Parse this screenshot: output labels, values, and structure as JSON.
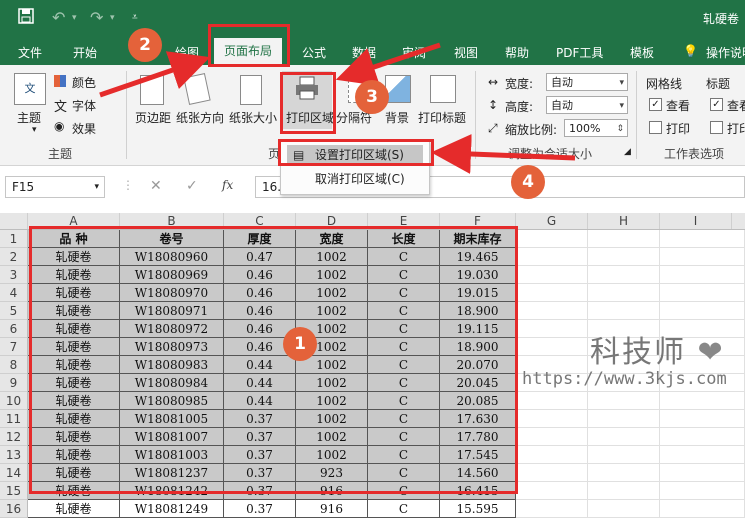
{
  "window": {
    "title": "轧硬卷"
  },
  "quick_access": {
    "save": "save-icon",
    "undo": "undo-icon",
    "redo": "redo-icon",
    "customize": "customize-icon"
  },
  "tabs": [
    "文件",
    "开始",
    "绘图",
    "页面布局",
    "公式",
    "数据",
    "审阅",
    "视图",
    "帮助",
    "PDF工具",
    "模板",
    "操作说明"
  ],
  "active_tab": "页面布局",
  "ribbon": {
    "themes": {
      "theme": "主题",
      "colors": "颜色",
      "fonts": "字体",
      "effects": "效果",
      "group": "主题"
    },
    "page_setup": {
      "margins": "页边距",
      "orientation": "纸张方向",
      "size": "纸张大小",
      "print_area": "打印区域",
      "breaks": "分隔符",
      "background": "背景",
      "print_titles": "打印标题",
      "group": "页"
    },
    "scale": {
      "width_label": "宽度:",
      "width_value": "自动",
      "height_label": "高度:",
      "height_value": "自动",
      "scale_label": "缩放比例:",
      "scale_value": "100%",
      "group": "调整为合适大小"
    },
    "sheet_options": {
      "gridlines": "网格线",
      "headings": "标题",
      "view": "查看",
      "print": "打印",
      "group": "工作表选项"
    }
  },
  "dropdown": {
    "set": "设置打印区域(S)",
    "cancel": "取消打印区域(C)"
  },
  "formula_bar": {
    "name_box": "F15",
    "fx": "fx",
    "content": "16.415"
  },
  "columns": [
    "A",
    "B",
    "C",
    "D",
    "E",
    "F",
    "G",
    "H",
    "I"
  ],
  "table": {
    "headers": [
      "品  种",
      "卷号",
      "厚度",
      "宽度",
      "长度",
      "期末库存"
    ],
    "rows": [
      [
        "轧硬卷",
        "W18080960",
        "0.47",
        "1002",
        "C",
        "19.465"
      ],
      [
        "轧硬卷",
        "W18080969",
        "0.46",
        "1002",
        "C",
        "19.030"
      ],
      [
        "轧硬卷",
        "W18080970",
        "0.46",
        "1002",
        "C",
        "19.015"
      ],
      [
        "轧硬卷",
        "W18080971",
        "0.46",
        "1002",
        "C",
        "18.900"
      ],
      [
        "轧硬卷",
        "W18080972",
        "0.46",
        "1002",
        "C",
        "19.115"
      ],
      [
        "轧硬卷",
        "W18080973",
        "0.46",
        "1002",
        "C",
        "18.900"
      ],
      [
        "轧硬卷",
        "W18080983",
        "0.44",
        "1002",
        "C",
        "20.070"
      ],
      [
        "轧硬卷",
        "W18080984",
        "0.44",
        "1002",
        "C",
        "20.045"
      ],
      [
        "轧硬卷",
        "W18080985",
        "0.44",
        "1002",
        "C",
        "20.085"
      ],
      [
        "轧硬卷",
        "W18081005",
        "0.37",
        "1002",
        "C",
        "17.630"
      ],
      [
        "轧硬卷",
        "W18081007",
        "0.37",
        "1002",
        "C",
        "17.780"
      ],
      [
        "轧硬卷",
        "W18081003",
        "0.37",
        "1002",
        "C",
        "17.545"
      ],
      [
        "轧硬卷",
        "W18081237",
        "0.37",
        "923",
        "C",
        "14.560"
      ],
      [
        "轧硬卷",
        "W18081242",
        "0.37",
        "916",
        "C",
        "16.415"
      ],
      [
        "轧硬卷",
        "W18081249",
        "0.37",
        "916",
        "C",
        "15.595"
      ]
    ]
  },
  "badges": [
    "1",
    "2",
    "3",
    "4"
  ],
  "watermark": {
    "name": "科技师",
    "url": "https://www.3kjs.com"
  },
  "colors": {
    "excel_green": "#217346",
    "annotation_red": "#e52b2b",
    "badge_orange": "#e4623a",
    "selection_gray": "#c9c9c9"
  }
}
